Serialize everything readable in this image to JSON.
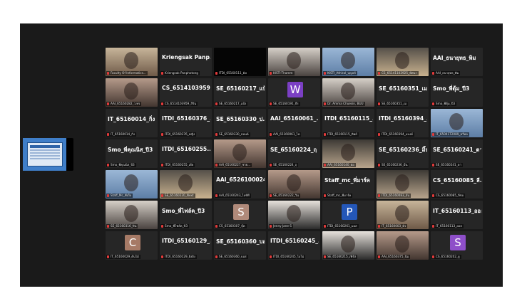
{
  "colors": {
    "active_border": "#9bd152",
    "mic_muted": "#e23b3b"
  },
  "tiles": [
    {
      "big": "",
      "label": "Faculty Of Informatics...",
      "kind": "photo",
      "active": true
    },
    {
      "big": "Kriengsak Panp...",
      "label": "Kriengsak Panphotong",
      "kind": "name"
    },
    {
      "big": "",
      "label": "ITDI_65160111_มิล",
      "kind": "black"
    },
    {
      "big": "",
      "label": "KISTI-Thamm",
      "kind": "photo"
    },
    {
      "big": "",
      "label": "KISTI_Athiral_บุญปลั",
      "kind": "photo"
    },
    {
      "big": "",
      "label": "CS_65141102925_ทัศนา",
      "kind": "photo"
    },
    {
      "big": "AAI_ธนายุทธ_พิม",
      "label": "AAI_ธนายุทธ_พิม",
      "kind": "name"
    },
    {
      "big": "",
      "label": "AAI_65160282_ว.ทร",
      "kind": "photo"
    },
    {
      "big": "CS_6514103959...",
      "label": "CS_6514103959_สิริน",
      "kind": "name"
    },
    {
      "big": "SE_65160217_แป้ง",
      "label": "SE_65160217_แป้ง",
      "kind": "name"
    },
    {
      "big": "",
      "label": "SE_65160191_ธีร",
      "kind": "letter",
      "letter": "W",
      "color": "#7b3fc4"
    },
    {
      "big": "",
      "label": "Dr. Amma Chuesin, BUU",
      "kind": "photo"
    },
    {
      "big": "SE_65160351_เม",
      "label": "SE_65160351_เม",
      "kind": "name"
    },
    {
      "big": "Smo_พี่ตุ้ม_ปี3",
      "label": "Smo_พี่ตุ้ม_ปี3",
      "kind": "name"
    },
    {
      "big": "IT_65160014_กิ่ง",
      "label": "IT_65160014_กิ่ง",
      "kind": "name"
    },
    {
      "big": "ITDI_65160376_...",
      "label": "ITDI_65160376_หญิง",
      "kind": "name"
    },
    {
      "big": "SE_65160330_ป...",
      "label": "SE_65160330_ปอนด์",
      "kind": "name"
    },
    {
      "big": "AAI_65160061_...",
      "label": "AAI_65160061_ไท",
      "kind": "name"
    },
    {
      "big": "ITDI_65160115_...",
      "label": "ITDI_65160115_ทิพย์",
      "kind": "name"
    },
    {
      "big": "ITDI_65160394_...",
      "label": "ITDI_65160394_แบงค์",
      "kind": "name"
    },
    {
      "big": "",
      "label": "IT_65041T2089_ทวีพล",
      "kind": "photo"
    },
    {
      "big": "Smo_พี่คุณนิส_ปี3",
      "label": "Smo_พี่คุณนิส_ปี3",
      "kind": "name"
    },
    {
      "big": "ITDI_65160255...",
      "label": "ITDI_65160255_เต้ย",
      "kind": "name"
    },
    {
      "big": "",
      "label": "AAI_65160227_ชาย...",
      "kind": "photo"
    },
    {
      "big": "SE_65160224_ฤ",
      "label": "SE_65160224_ฤ",
      "kind": "name"
    },
    {
      "big": "",
      "label": "AAI_65160140_ต่อ",
      "kind": "photo"
    },
    {
      "big": "SE_65160236_มิ้น",
      "label": "SE_65160236_มิ้น",
      "kind": "name"
    },
    {
      "big": "SE_65160241_ดา",
      "label": "SE_65160241_ดา",
      "kind": "name"
    },
    {
      "big": "",
      "label": "Staff_Mc_พี่เบิ้ล",
      "kind": "photo"
    },
    {
      "big": "",
      "label": "SE_65160220_Next",
      "kind": "photo"
    },
    {
      "big": "AAI_6526100024...",
      "label": "AAI_65160243_ไอซ์ที",
      "kind": "name"
    },
    {
      "big": "",
      "label": "SE_65160222_วิน",
      "kind": "photo"
    },
    {
      "big": "Staff_mc_พี่มาร์ค",
      "label": "Staff_mc_พี่มาร์ค",
      "kind": "name"
    },
    {
      "big": "",
      "label": "ITDI_65160083_อัน",
      "kind": "photo"
    },
    {
      "big": "CS_65160085_ลี...",
      "label": "CS_65160085_ลีซอ",
      "kind": "name"
    },
    {
      "big": "",
      "label": "SE_65160316_ปิ่น",
      "kind": "photo"
    },
    {
      "big": "Smo_พี่ไฟล์ค_ปี3",
      "label": "Smo_พี่ไฟล์ค_ปี3",
      "kind": "name"
    },
    {
      "big": "",
      "label": "CS_65160307_บุ๊ค",
      "kind": "letter",
      "letter": "S",
      "color": "#b08a7a"
    },
    {
      "big": "",
      "label": "Jenny Jane S",
      "kind": "photo"
    },
    {
      "big": "",
      "label": "ITDI_65160261_มอส",
      "kind": "letter",
      "letter": "P",
      "color": "#2457b8"
    },
    {
      "big": "",
      "label": "IT_65160003_มิว",
      "kind": "photo"
    },
    {
      "big": "IT_65160113_ออย",
      "label": "IT_65160113_ออย",
      "kind": "name"
    },
    {
      "big": "",
      "label": "IT_65160029_ต้นไม้",
      "kind": "letter",
      "letter": "C",
      "color": "#a67a66"
    },
    {
      "big": "ITDI_65160129_...",
      "label": "ITDI_65160129_ผิงผิง",
      "kind": "name"
    },
    {
      "big": "SE_65160360_บอส",
      "label": "SE_65160360_บอส",
      "kind": "name"
    },
    {
      "big": "ITDI_65160245_...",
      "label": "ITDI_65160245_ไอโม่",
      "kind": "name"
    },
    {
      "big": "",
      "label": "SE_65160215_เฟิร์ส",
      "kind": "photo"
    },
    {
      "big": "",
      "label": "AAI_65160375_นิม",
      "kind": "photo"
    },
    {
      "big": "",
      "label": "CS_65160202_ยู",
      "kind": "letter",
      "letter": "S",
      "color": "#8e4fc9"
    }
  ]
}
